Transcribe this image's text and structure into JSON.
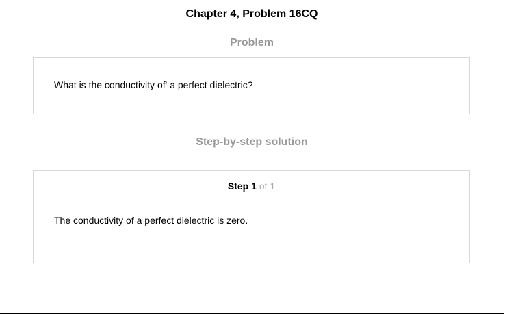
{
  "header": {
    "title": "Chapter 4, Problem 16CQ"
  },
  "problem": {
    "heading": "Problem",
    "text": "What is the conductivity of' a perfect dielectric?"
  },
  "solution": {
    "heading": "Step-by-step solution",
    "step_label": "Step 1",
    "step_of": "of 1",
    "text": "The conductivity of a perfect dielectric is zero."
  },
  "colors": {
    "heading_gray": "#999999",
    "step_of_gray": "#aaaaaa",
    "card_border": "#d8d8d8"
  }
}
